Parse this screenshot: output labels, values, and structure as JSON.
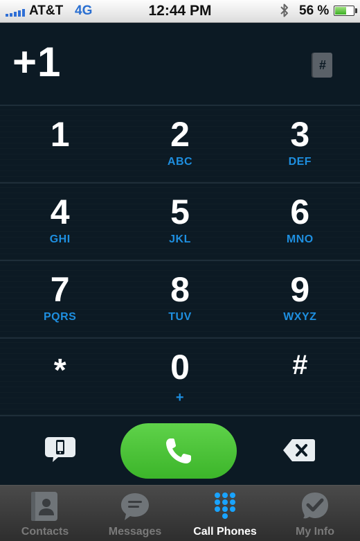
{
  "status_bar": {
    "carrier": "AT&T",
    "network": "4G",
    "time": "12:44 PM",
    "battery_text": "56 %",
    "battery_level": 0.56,
    "signal_bars": 5
  },
  "display": {
    "number": "+1",
    "contacts_icon": "contacts-book-icon",
    "contacts_glyph": "#"
  },
  "keypad": {
    "keys": [
      {
        "digit": "1",
        "letters": ""
      },
      {
        "digit": "2",
        "letters": "ABC"
      },
      {
        "digit": "3",
        "letters": "DEF"
      },
      {
        "digit": "4",
        "letters": "GHI"
      },
      {
        "digit": "5",
        "letters": "JKL"
      },
      {
        "digit": "6",
        "letters": "MNO"
      },
      {
        "digit": "7",
        "letters": "PQRS"
      },
      {
        "digit": "8",
        "letters": "TUV"
      },
      {
        "digit": "9",
        "letters": "WXYZ"
      },
      {
        "digit": "*",
        "letters": ""
      },
      {
        "digit": "0",
        "letters": "+"
      },
      {
        "digit": "#",
        "letters": ""
      }
    ]
  },
  "actions": {
    "left_icon": "phone-mode-icon",
    "call_icon": "phone-handset-icon",
    "right_icon": "backspace-icon"
  },
  "tab_bar": {
    "tabs": [
      {
        "label": "Contacts",
        "icon": "contacts-icon",
        "active": false
      },
      {
        "label": "Messages",
        "icon": "chat-bubble-icon",
        "active": false
      },
      {
        "label": "Call Phones",
        "icon": "dialpad-icon",
        "active": true
      },
      {
        "label": "My Info",
        "icon": "check-badge-icon",
        "active": false
      }
    ]
  },
  "colors": {
    "background": "#0c1a24",
    "accent_blue": "#1e8fe0",
    "call_green": "#4cc23a",
    "tab_inactive": "#7a7a7a"
  }
}
